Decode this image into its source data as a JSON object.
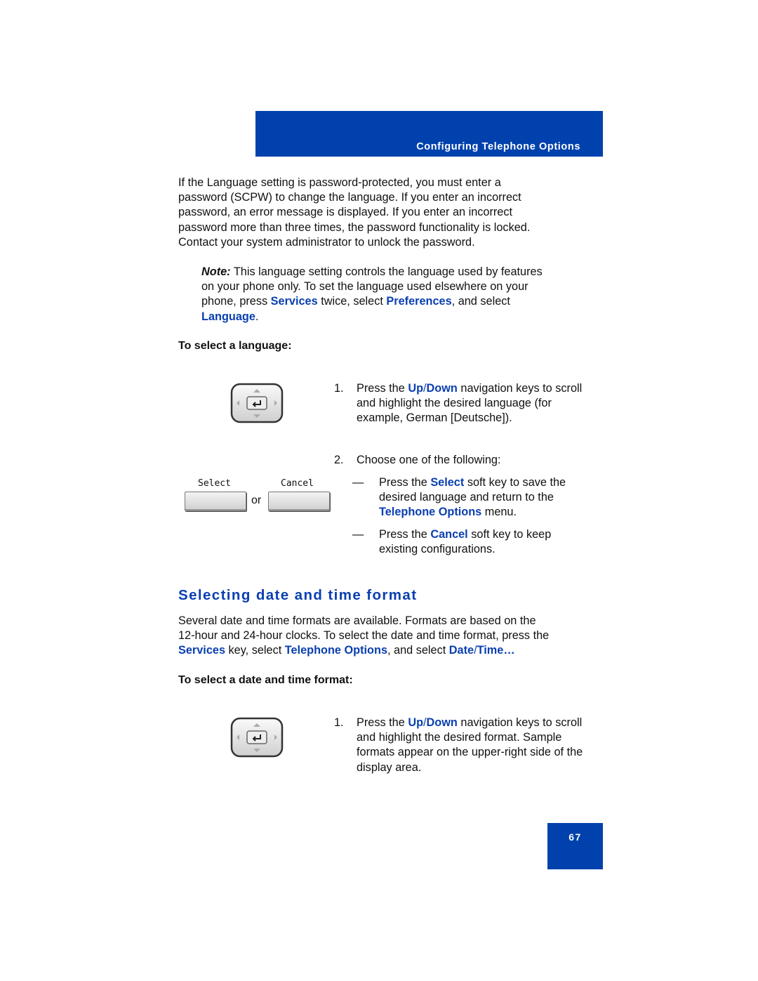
{
  "header": {
    "section_title": "Configuring Telephone Options"
  },
  "intro": {
    "lines": [
      "If the Language setting is password-protected, you must enter a",
      "password (SCPW) to change the language. If you enter an incorrect",
      "password, an error message is displayed. If you enter an incorrect",
      "password more than three times, the password functionality is locked.",
      "Contact your system administrator to unlock the password."
    ]
  },
  "note": {
    "label": "Note:",
    "line1": " This language setting controls the language used by features",
    "line2": "on your phone only. To set the language used elsewhere on your",
    "line3_a": "phone, press ",
    "services": "Services",
    "line3_b": " twice, select ",
    "preferences": "Preferences",
    "line3_c": ", and select",
    "language": "Language",
    "line4_end": "."
  },
  "procedure1": {
    "title": "To select a language:",
    "step1": {
      "num": "1.",
      "a": "Press the ",
      "up": "Up",
      "slash": "/",
      "down": "Down",
      "b": " navigation keys to scroll and highlight the desired language (for example, German [Deutsche])."
    },
    "step2": {
      "num": "2.",
      "text": "Choose one of the following:"
    },
    "softkeys": {
      "select_label": "Select",
      "cancel_label": "Cancel",
      "or": "or"
    },
    "options": [
      {
        "dash": "—",
        "a": "Press the ",
        "key": "Select",
        "b": " soft key to save the desired language and return to the ",
        "menu": "Telephone Options",
        "c": " menu."
      },
      {
        "dash": "—",
        "a": "Press the ",
        "key": "Cancel",
        "b": " soft key to keep existing configurations."
      }
    ]
  },
  "section2": {
    "heading": "Selecting date and time format",
    "line1": "Several date and time formats are available. Formats are based on the",
    "line2": "12-hour and 24-hour clocks. To select the date and time format, press the",
    "services": "Services",
    "l3a": " key, select ",
    "telephone_options": "Telephone Options",
    "l3b": ", and select ",
    "date": "Date",
    "slash": "/",
    "time": "Time…"
  },
  "procedure2": {
    "title": "To select a date and time format:",
    "step1": {
      "num": "1.",
      "a": "Press the ",
      "up": "Up",
      "slash": "/",
      "down": "Down",
      "b": " navigation keys to scroll and highlight the desired format. Sample formats appear on the upper-right side of the display area."
    }
  },
  "footer": {
    "page_number": "67"
  },
  "colors": {
    "brand_blue": "#0041ad",
    "link_blue": "#0a3fb0"
  }
}
